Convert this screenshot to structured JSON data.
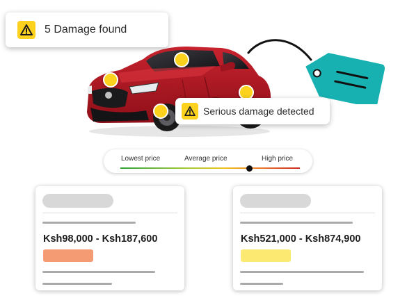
{
  "damage_badge": {
    "icon": "warning-icon",
    "text": "5 Damage found"
  },
  "serious_badge": {
    "icon": "warning-icon",
    "text": "Serious damage detected"
  },
  "price_tag": {
    "icon": "price-tag-icon",
    "color": "#17b1b1"
  },
  "damage_markers": {
    "count": 4,
    "color": "#fcd21e"
  },
  "price_scale": {
    "labels": {
      "low": "Lowest price",
      "average": "Average price",
      "high": "High price"
    },
    "marker_position": 0.72
  },
  "cards": [
    {
      "price": "Ksh98,000 - Ksh187,600",
      "swatch_color": "#f59b73"
    },
    {
      "price": "Ksh521,000 - Ksh874,900",
      "swatch_color": "#fbe971"
    }
  ],
  "colors": {
    "warning": "#fcd21e",
    "car_body": "#b11722",
    "tag": "#17b1b1"
  }
}
